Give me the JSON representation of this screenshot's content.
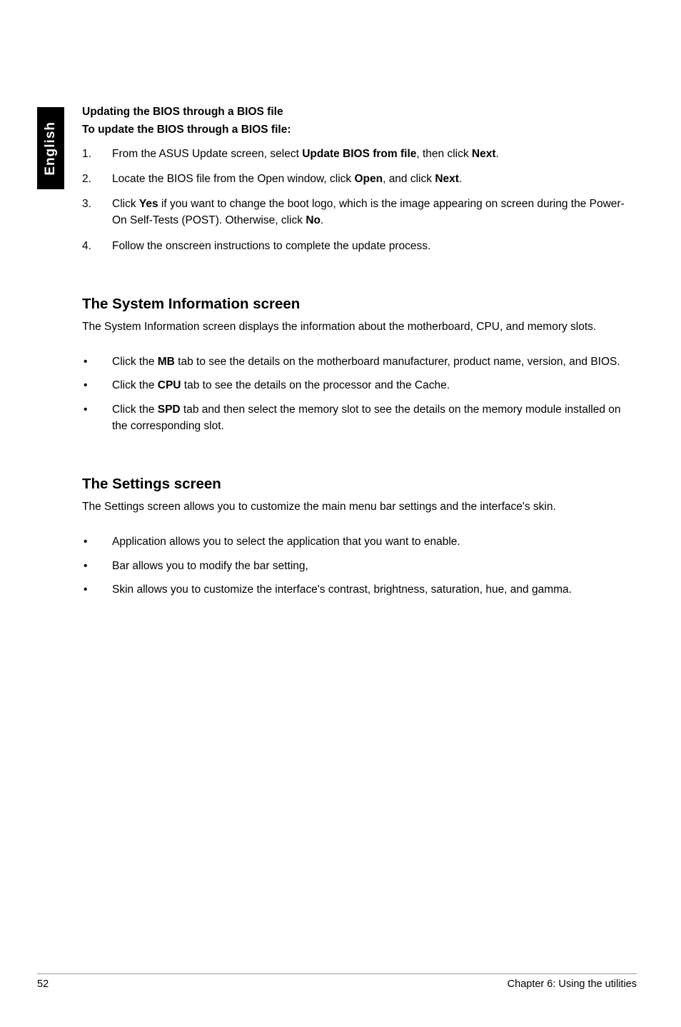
{
  "sideTab": "English",
  "headings": {
    "updatingBios": "Updating the BIOS through a BIOS file",
    "toUpdate": "To update the BIOS through a BIOS file:",
    "systemInfo": "The System Information screen",
    "settings": "The Settings screen"
  },
  "steps": {
    "s1": {
      "num": "1.",
      "pre": "From the ASUS Update screen, select ",
      "bold1": "Update BIOS from file",
      "mid": ", then click ",
      "bold2": "Next",
      "post": "."
    },
    "s2": {
      "num": "2.",
      "pre": "Locate the BIOS file from the Open window, click ",
      "bold1": "Open",
      "mid": ", and click ",
      "bold2": "Next",
      "post": "."
    },
    "s3": {
      "num": "3.",
      "pre": "Click ",
      "bold1": "Yes",
      "mid": " if you want to change the boot logo, which is the image appearing on screen during the Power-On Self-Tests (POST). Otherwise, click ",
      "bold2": "No",
      "post": "."
    },
    "s4": {
      "num": "4.",
      "text": "Follow the onscreen instructions to complete the update process."
    }
  },
  "systemInfoIntro": "The System Information screen displays the information about the motherboard, CPU, and memory slots.",
  "systemInfoBullets": {
    "b1": {
      "pre": "Click the ",
      "bold": "MB",
      "post": " tab to see the details on the motherboard manufacturer, product name, version, and BIOS."
    },
    "b2": {
      "pre": "Click the ",
      "bold": "CPU",
      "post": " tab to see the details on the processor and the Cache."
    },
    "b3": {
      "pre": "Click the ",
      "bold": "SPD",
      "post": " tab and then select the memory slot to see the details on the memory module installed on the corresponding slot."
    }
  },
  "settingsIntro": "The Settings screen allows you to customize the main menu bar settings and the interface's skin.",
  "settingsBullets": {
    "b1": "Application allows you to select the application that you want to enable.",
    "b2": "Bar allows you to modify the bar setting,",
    "b3": "Skin allows you to customize the interface's contrast, brightness, saturation, hue, and gamma."
  },
  "bulletChar": "•",
  "footer": {
    "pageNum": "52",
    "chapter": "Chapter 6: Using the utilities"
  }
}
